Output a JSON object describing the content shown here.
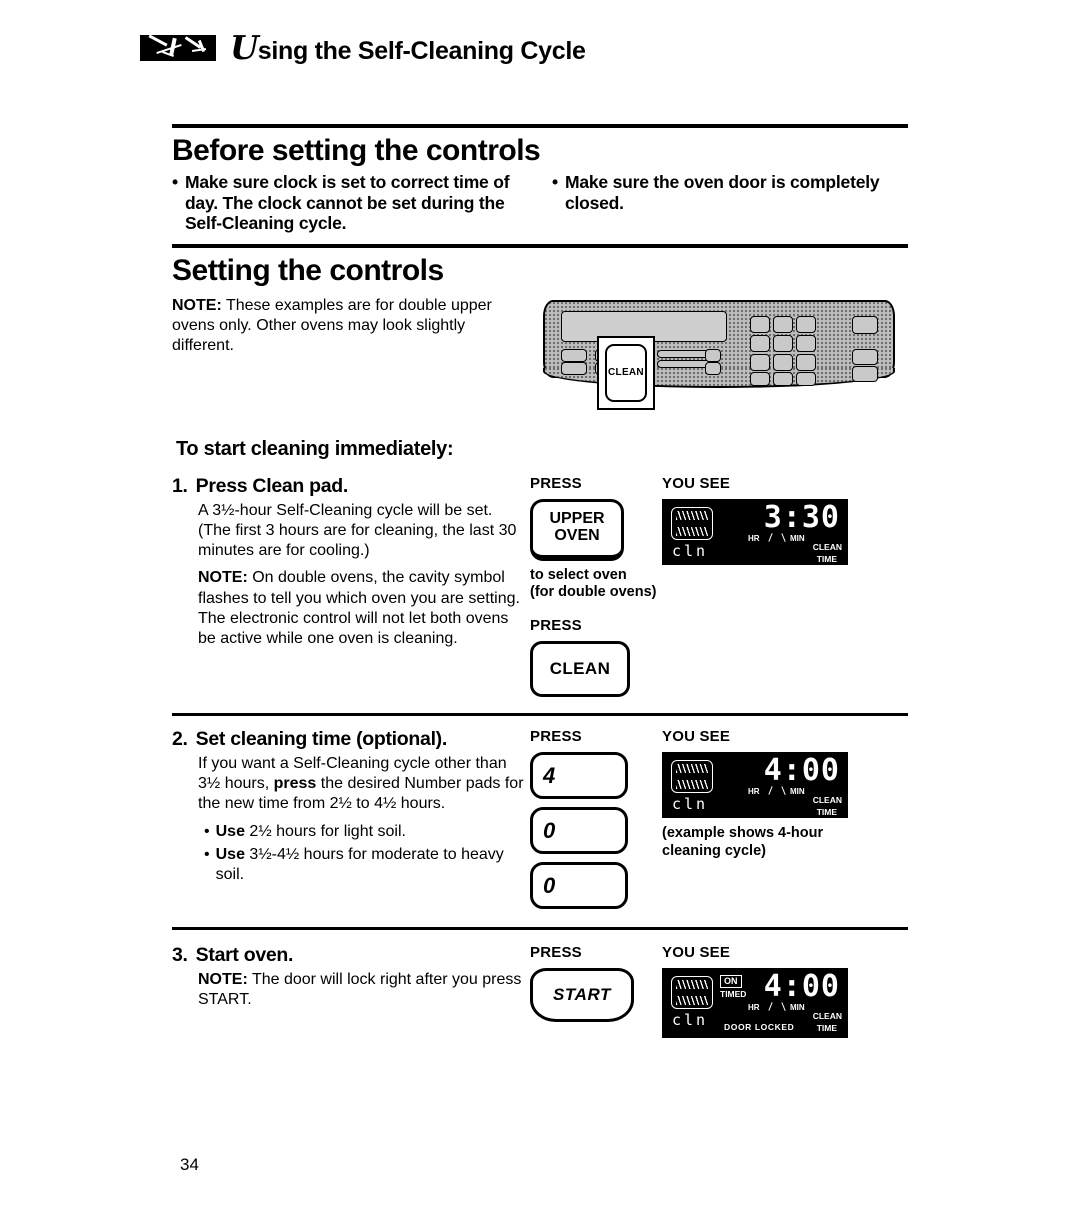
{
  "header": {
    "title_script": "U",
    "title_rest": "sing the Self-Cleaning Cycle",
    "ink_block_icon": "ink-brush-block"
  },
  "before_section": {
    "title": "Before setting the controls",
    "bullets": [
      "Make sure clock is set to correct time of day. The clock cannot be set during the Self-Cleaning cycle.",
      "Make sure the oven door is completely closed."
    ]
  },
  "setting_section": {
    "title": "Setting the controls",
    "note_label": "NOTE:",
    "note_text": " These examples are for double upper ovens only. Other ovens may look slightly different.",
    "panel": {
      "callout_label": "CLEAN"
    }
  },
  "lead_in": "To start cleaning immediately:",
  "columns": {
    "press": "PRESS",
    "you_see": "YOU SEE"
  },
  "steps": [
    {
      "number": "1.",
      "title": "Press Clean pad.",
      "paragraph1": "A 3½-hour Self-Cleaning cycle will be set. (The first 3 hours are for cleaning, the last 30 minutes are for cooling.)",
      "note_label": "NOTE:",
      "note_text": " On double ovens, the cavity symbol flashes to tell you which oven you are setting. The electronic control will not let both ovens be active while one oven is cleaning.",
      "keys": [
        {
          "line1": "UPPER",
          "line2": "OVEN"
        },
        {
          "line1": "CLEAN"
        }
      ],
      "key_caption": "to select oven\n(for double ovens)",
      "key_caption_line1": "to select oven",
      "key_caption_line2": "(for double ovens)",
      "display": {
        "digits": "3:30",
        "hr": "HR",
        "min": "MIN",
        "clean": "CLEAN",
        "time": "TIME",
        "cavity_text": "cln"
      }
    },
    {
      "number": "2.",
      "title": "Set cleaning time (optional).",
      "paragraph1_a": "If you want a Self-Cleaning cycle other than 3½ hours, ",
      "paragraph1_bold": "press",
      "paragraph1_b": " the desired Number pads for the new time from 2½ to 4½ hours.",
      "bullets": [
        {
          "bold": "Use",
          "rest": " 2½ hours for light soil."
        },
        {
          "bold": "Use",
          "rest": " 3½-4½ hours for moderate to heavy soil."
        }
      ],
      "number_keys": [
        "4",
        "0",
        "0"
      ],
      "display": {
        "digits": "4:00",
        "hr": "HR",
        "min": "MIN",
        "clean": "CLEAN",
        "time": "TIME",
        "cavity_text": "cln"
      },
      "display_caption_line1": "(example shows 4-hour",
      "display_caption_line2": "cleaning cycle)"
    },
    {
      "number": "3.",
      "title": "Start oven.",
      "note_label": "NOTE:",
      "note_text": " The door will lock right after you press START.",
      "key_label": "START",
      "display": {
        "digits": "4:00",
        "on_badge": "ON",
        "timed": "TIMED",
        "hr": "HR",
        "min": "MIN",
        "clean": "CLEAN",
        "time": "TIME",
        "door_locked": "DOOR LOCKED",
        "cavity_text": "cln"
      }
    }
  ],
  "page_number": "34"
}
